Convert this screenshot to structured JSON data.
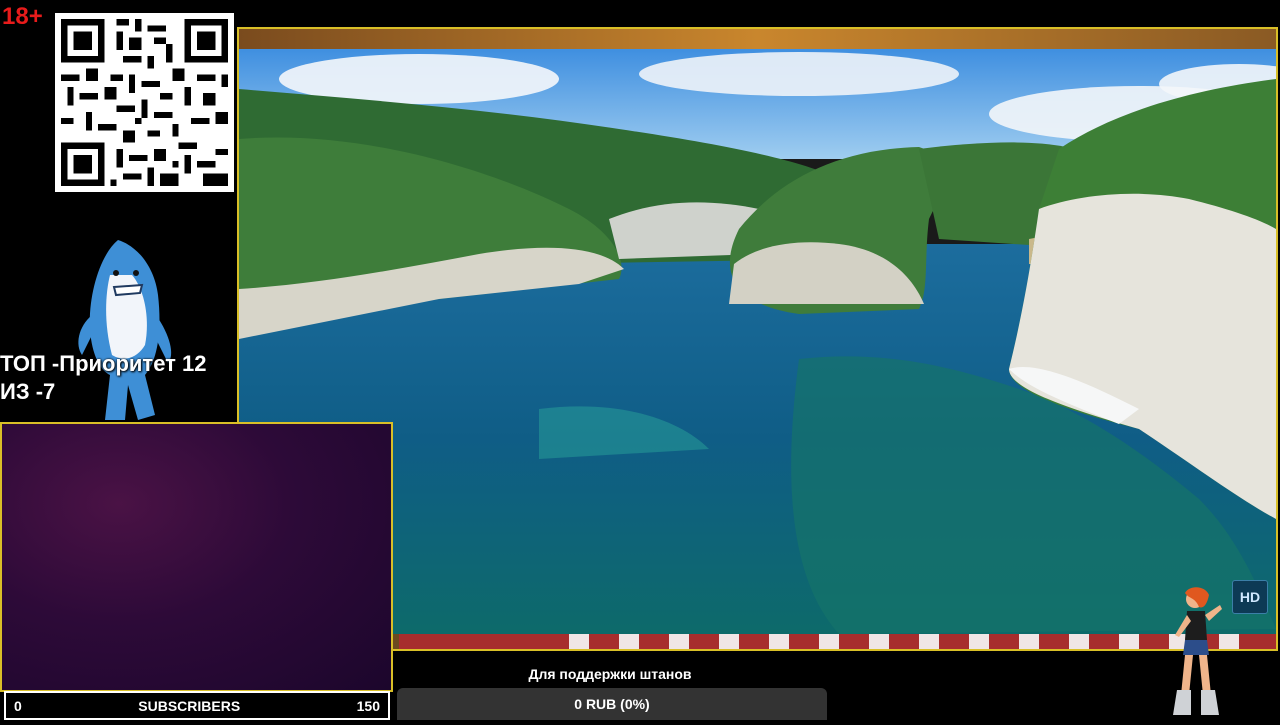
{
  "age_rating": "18+",
  "top_info": {
    "line1": "ТОП -Приоритет 12",
    "line2": "ИЗ -7"
  },
  "video": {
    "quality_badge": "HD"
  },
  "subscribers": {
    "min": "0",
    "label": "SUBSCRIBERS",
    "max": "150",
    "progress": 0
  },
  "donation": {
    "title": "Для поддержки штанов",
    "status": "0 RUB (0%)",
    "progress": 0
  },
  "colors": {
    "frame_border": "#d9bf27",
    "age_badge": "#e81b1b",
    "progress_fill": "#55b24c"
  },
  "icons": [
    "qr-code-icon",
    "shark-mascot",
    "dancer-figure",
    "hd-badge"
  ]
}
